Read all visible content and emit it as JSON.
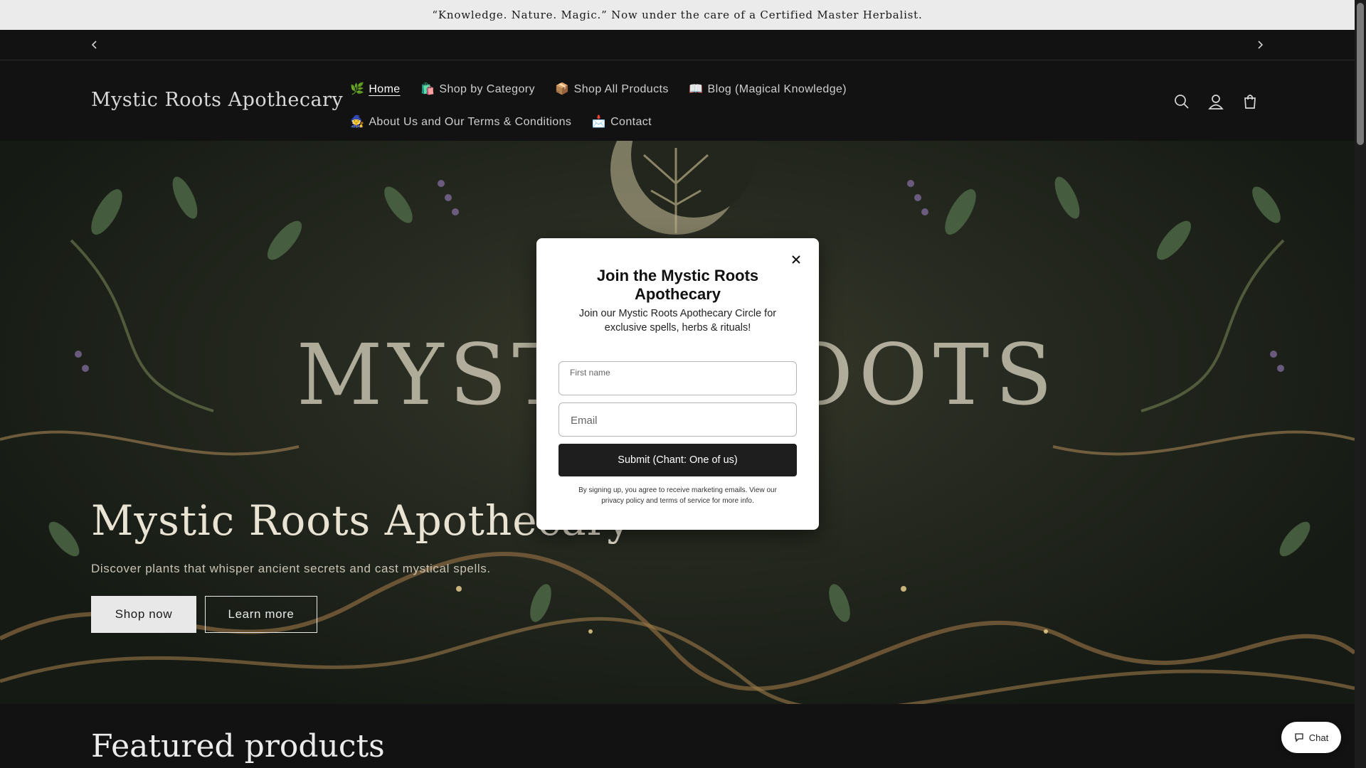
{
  "announcement": "“Knowledge. Nature. Magic.” Now under the care of a Certified Master Herbalist.",
  "header": {
    "logo": "Mystic Roots Apothecary",
    "nav": [
      {
        "emoji": "🌿",
        "label": "Home",
        "active": true
      },
      {
        "emoji": "🛍️",
        "label": "Shop by Category"
      },
      {
        "emoji": "📦",
        "label": "Shop All Products"
      },
      {
        "emoji": "📖",
        "label": "Blog (Magical Knowledge)"
      },
      {
        "emoji": "🧙",
        "label": "About Us and Our Terms & Conditions"
      },
      {
        "emoji": "📩",
        "label": "Contact"
      }
    ],
    "icons": [
      "search-icon",
      "account-icon",
      "cart-icon"
    ]
  },
  "hero": {
    "image_text": "MYSTIC ROOTS",
    "title": "Mystic Roots Apothecary",
    "subtitle": "Discover plants that whisper ancient secrets and cast mystical spells.",
    "primary_button": "Shop now",
    "secondary_button": "Learn more"
  },
  "featured": {
    "title": "Featured products"
  },
  "modal": {
    "title": "Join the Mystic Roots Apothecary",
    "description": "Join our Mystic Roots Apothecary Circle for exclusive spells, herbs & rituals!",
    "first_name_label": "First name",
    "email_placeholder": "Email",
    "submit_label": "Submit (Chant: One of us)",
    "legal": "By signing up, you agree to receive marketing emails. View our privacy policy and terms of service for more info."
  },
  "chat": {
    "label": "Chat"
  },
  "colors": {
    "background": "#121212",
    "announcement_bg": "#ebebeb",
    "modal_bg": "#ffffff",
    "submit_bg": "#1e1e1e"
  }
}
